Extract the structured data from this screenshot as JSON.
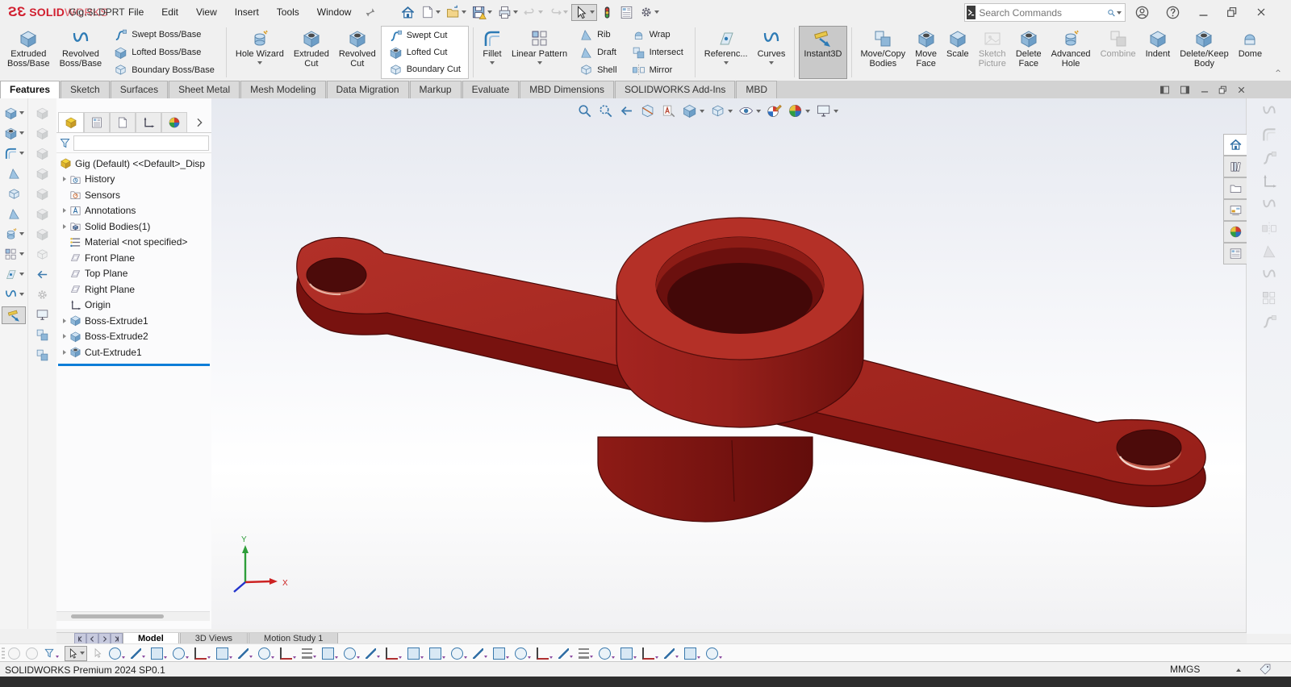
{
  "window": {
    "logo_prefix": "ЗS",
    "logo_solid": "SOLID",
    "logo_works": "WORKS",
    "title": "Gig.SLDPRT",
    "status_left": "SOLIDWORKS Premium 2024 SP0.1",
    "units": "MMGS"
  },
  "menus": [
    "File",
    "Edit",
    "View",
    "Insert",
    "Tools",
    "Window"
  ],
  "search": {
    "placeholder": "Search Commands"
  },
  "ribbon": {
    "extruded_boss": {
      "l1": "Extruded",
      "l2": "Boss/Base"
    },
    "revolved_boss": {
      "l1": "Revolved",
      "l2": "Boss/Base"
    },
    "swept_boss": "Swept Boss/Base",
    "lofted_boss": "Lofted Boss/Base",
    "boundary_boss": "Boundary Boss/Base",
    "hole_wizard": {
      "l1": "Hole Wizard",
      "l2": ""
    },
    "extruded_cut": {
      "l1": "Extruded",
      "l2": "Cut"
    },
    "revolved_cut": {
      "l1": "Revolved",
      "l2": "Cut"
    },
    "swept_cut": "Swept Cut",
    "lofted_cut": "Lofted Cut",
    "boundary_cut": "Boundary Cut",
    "fillet": "Fillet",
    "linear_pattern": "Linear Pattern",
    "rib": "Rib",
    "draft": "Draft",
    "shell": "Shell",
    "wrap": "Wrap",
    "intersect": "Intersect",
    "mirror": "Mirror",
    "reference": "Referenc...",
    "curves": "Curves",
    "instant3d": "Instant3D",
    "move_copy": {
      "l1": "Move/Copy",
      "l2": "Bodies"
    },
    "move_face": {
      "l1": "Move",
      "l2": "Face"
    },
    "scale": "Scale",
    "sketch_picture": {
      "l1": "Sketch",
      "l2": "Picture"
    },
    "delete_face": {
      "l1": "Delete",
      "l2": "Face"
    },
    "advanced_hole": {
      "l1": "Advanced",
      "l2": "Hole"
    },
    "combine": "Combine",
    "indent": "Indent",
    "delete_keep": {
      "l1": "Delete/Keep",
      "l2": "Body"
    },
    "dome": "Dome"
  },
  "tabs": [
    "Features",
    "Sketch",
    "Surfaces",
    "Sheet Metal",
    "Mesh Modeling",
    "Data Migration",
    "Markup",
    "Evaluate",
    "MBD Dimensions",
    "SOLIDWORKS Add-Ins",
    "MBD"
  ],
  "feature_tree": {
    "root": "Gig (Default) <<Default>_Disp",
    "items": [
      {
        "label": "History"
      },
      {
        "label": "Sensors"
      },
      {
        "label": "Annotations"
      },
      {
        "label": "Solid Bodies(1)"
      },
      {
        "label": "Material <not specified>"
      },
      {
        "label": "Front Plane"
      },
      {
        "label": "Top Plane"
      },
      {
        "label": "Right Plane"
      },
      {
        "label": "Origin"
      },
      {
        "label": "Boss-Extrude1"
      },
      {
        "label": "Boss-Extrude2"
      },
      {
        "label": "Cut-Extrude1"
      }
    ]
  },
  "bottom_tabs": [
    "Model",
    "3D Views",
    "Motion Study 1"
  ],
  "triad": {
    "x": "X",
    "y": "Y"
  },
  "colors": {
    "part_top": "#ab2a22",
    "part_side": "#78120f",
    "part_ring": "#b43027",
    "bore_dark": "#4f0c0b",
    "rollback_bar": "#0d7ed8",
    "logo_red": "#d11f2f"
  },
  "icons": {
    "headsup": [
      "zoom-to-fit",
      "zoom-to-area",
      "previous-view",
      "section-view",
      "dynamic-annotation-views",
      "view-orientation",
      "display-style",
      "hide-show-items",
      "edit-appearance",
      "apply-scene",
      "view-settings"
    ],
    "task_pane": [
      "home",
      "design-library",
      "file-explorer",
      "view-palette",
      "appearances-scenes",
      "custom-properties"
    ]
  }
}
